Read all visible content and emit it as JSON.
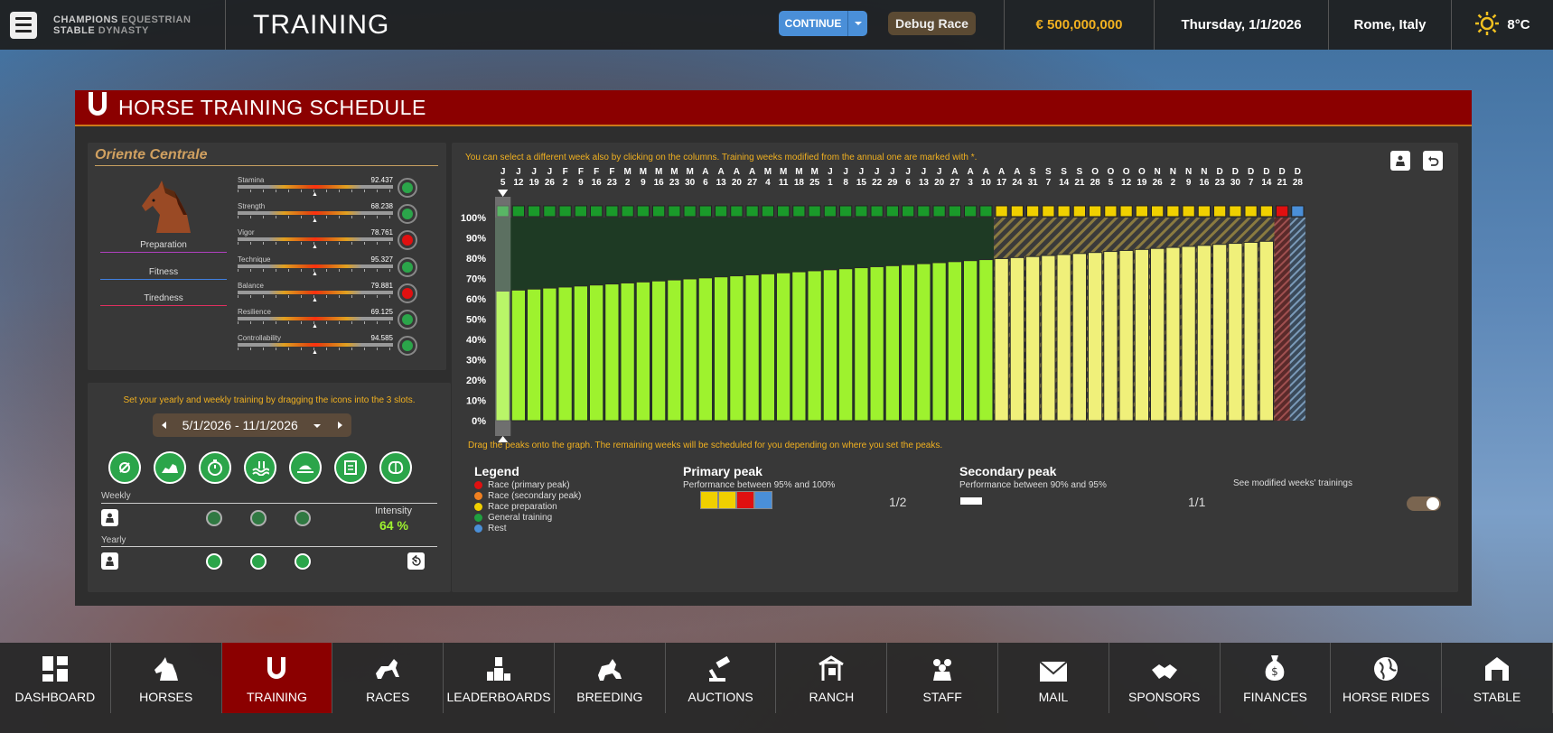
{
  "topbar": {
    "logo_line1": "CHAMPIONS",
    "logo_line2": "STABLE",
    "logo_line3": "EQUESTRIAN",
    "logo_line4": "DYNASTY",
    "page_title": "TRAINING",
    "continue_label": "CONTINUE",
    "debug_label": "Debug Race",
    "money": "€ 500,000,000",
    "date": "Thursday, 1/1/2026",
    "location": "Rome, Italy",
    "temperature": "8°C"
  },
  "panel": {
    "title": "HORSE TRAINING SCHEDULE",
    "horse_name": "Oriente Centrale",
    "conditions": [
      "Preparation",
      "Fitness",
      "Tiredness"
    ],
    "stats": [
      {
        "name": "Stamina",
        "value": "92.437",
        "status": "green"
      },
      {
        "name": "Strength",
        "value": "68.238",
        "status": "green"
      },
      {
        "name": "Vigor",
        "value": "78.761",
        "status": "red"
      },
      {
        "name": "Technique",
        "value": "95.327",
        "status": "green"
      },
      {
        "name": "Balance",
        "value": "79.881",
        "status": "red"
      },
      {
        "name": "Resilience",
        "value": "69.125",
        "status": "green"
      },
      {
        "name": "Controllability",
        "value": "94.585",
        "status": "green"
      }
    ],
    "training_hint": "Set your yearly and weekly training by dragging the icons into the 3 slots.",
    "week_range": "5/1/2026 - 11/1/2026",
    "weekly_label": "Weekly",
    "yearly_label": "Yearly",
    "intensity_label": "Intensity",
    "intensity_value": "64 %",
    "chart_hint": "You can select a different week also by clicking on the columns. Training weeks modified from the annual one are marked with *.",
    "drag_hint": "Drag the peaks onto the graph. The remaining weeks will be scheduled for you depending on where you set the peaks.",
    "legend_title": "Legend",
    "legend": [
      {
        "label": "Race (primary peak)",
        "color": "#e01010"
      },
      {
        "label": "Race (secondary peak)",
        "color": "#f08020"
      },
      {
        "label": "Race preparation",
        "color": "#f0d000"
      },
      {
        "label": "General training",
        "color": "#20a040"
      },
      {
        "label": "Rest",
        "color": "#4a8fd8"
      }
    ],
    "primary_peak_title": "Primary peak",
    "primary_peak_desc": "Performance between 95% and 100%",
    "primary_peak_count": "1/2",
    "secondary_peak_title": "Secondary peak",
    "secondary_peak_desc": "Performance between 90% and 95%",
    "secondary_peak_count": "1/1",
    "modified_label": "See modified weeks' trainings"
  },
  "chart_data": {
    "type": "bar",
    "ylim": [
      0,
      100
    ],
    "yticks": [
      "100%",
      "90%",
      "80%",
      "70%",
      "60%",
      "50%",
      "40%",
      "30%",
      "20%",
      "10%",
      "0%"
    ],
    "week_months": [
      "J",
      "J",
      "J",
      "J",
      "F",
      "F",
      "F",
      "F",
      "M",
      "M",
      "M",
      "M",
      "M",
      "A",
      "A",
      "A",
      "A",
      "M",
      "M",
      "M",
      "M",
      "J",
      "J",
      "J",
      "J",
      "J",
      "J",
      "J",
      "J",
      "A",
      "A",
      "A",
      "A",
      "A",
      "S",
      "S",
      "S",
      "S",
      "O",
      "O",
      "O",
      "O",
      "N",
      "N",
      "N",
      "N",
      "D",
      "D",
      "D",
      "D"
    ],
    "week_days": [
      "5",
      "12",
      "19",
      "26",
      "2",
      "9",
      "16",
      "23",
      "2",
      "9",
      "16",
      "23",
      "30",
      "6",
      "13",
      "20",
      "27",
      "4",
      "11",
      "18",
      "25",
      "1",
      "8",
      "15",
      "22",
      "29",
      "6",
      "13",
      "20",
      "27",
      "3",
      "10",
      "17",
      "24",
      "31",
      "7",
      "14",
      "21",
      "28",
      "5",
      "12",
      "19",
      "26",
      "2",
      "9",
      "16",
      "23",
      "30",
      "7",
      "14"
    ],
    "extra_month_labels": [
      "D",
      "D"
    ],
    "extra_day_labels": [
      "21",
      "28"
    ],
    "values": [
      63.8,
      64.3,
      64.8,
      65.3,
      65.8,
      66.3,
      66.8,
      67.3,
      67.8,
      68.3,
      68.8,
      69.3,
      69.8,
      70.3,
      70.8,
      71.3,
      71.8,
      72.3,
      72.8,
      73.3,
      73.8,
      74.3,
      74.8,
      75.3,
      75.8,
      76.3,
      76.8,
      77.3,
      77.8,
      78.3,
      78.8,
      79.3,
      79.8,
      80.3,
      80.8,
      81.3,
      81.8,
      82.3,
      82.8,
      83.3,
      83.8,
      84.3,
      84.8,
      85.3,
      85.8,
      86.3,
      86.8,
      87.3,
      87.8,
      88.3
    ],
    "week_types": [
      "general",
      "general",
      "general",
      "general",
      "general",
      "general",
      "general",
      "general",
      "general",
      "general",
      "general",
      "general",
      "general",
      "general",
      "general",
      "general",
      "general",
      "general",
      "general",
      "general",
      "general",
      "general",
      "general",
      "general",
      "general",
      "general",
      "general",
      "general",
      "general",
      "general",
      "general",
      "general",
      "prep",
      "prep",
      "prep",
      "prep",
      "prep",
      "prep",
      "prep",
      "prep",
      "prep",
      "prep",
      "prep",
      "prep",
      "prep",
      "prep",
      "prep",
      "prep",
      "prep",
      "prep",
      "primary",
      "rest"
    ],
    "colors": {
      "general_bar": "#9ef22e",
      "prep_bar": "#f0f07a",
      "general_strip": "#1a9a2a",
      "prep_strip": "#f0d000",
      "primary_strip": "#e01010",
      "rest_strip": "#4a8fd8"
    }
  },
  "bottom_nav": [
    {
      "label": "DASHBOARD",
      "icon": "dashboard-icon"
    },
    {
      "label": "HORSES",
      "icon": "horse-head-icon"
    },
    {
      "label": "TRAINING",
      "icon": "horseshoe-icon",
      "active": true
    },
    {
      "label": "RACES",
      "icon": "racing-horse-icon"
    },
    {
      "label": "LEADERBOARDS",
      "icon": "trophy-icon"
    },
    {
      "label": "BREEDING",
      "icon": "breeding-icon"
    },
    {
      "label": "AUCTIONS",
      "icon": "gavel-icon"
    },
    {
      "label": "RANCH",
      "icon": "ranch-icon"
    },
    {
      "label": "STAFF",
      "icon": "staff-icon"
    },
    {
      "label": "MAIL",
      "icon": "mail-icon"
    },
    {
      "label": "SPONSORS",
      "icon": "handshake-icon"
    },
    {
      "label": "FINANCES",
      "icon": "money-bag-icon"
    },
    {
      "label": "HORSE RIDES",
      "icon": "globe-icon"
    },
    {
      "label": "STABLE",
      "icon": "stable-icon"
    }
  ]
}
